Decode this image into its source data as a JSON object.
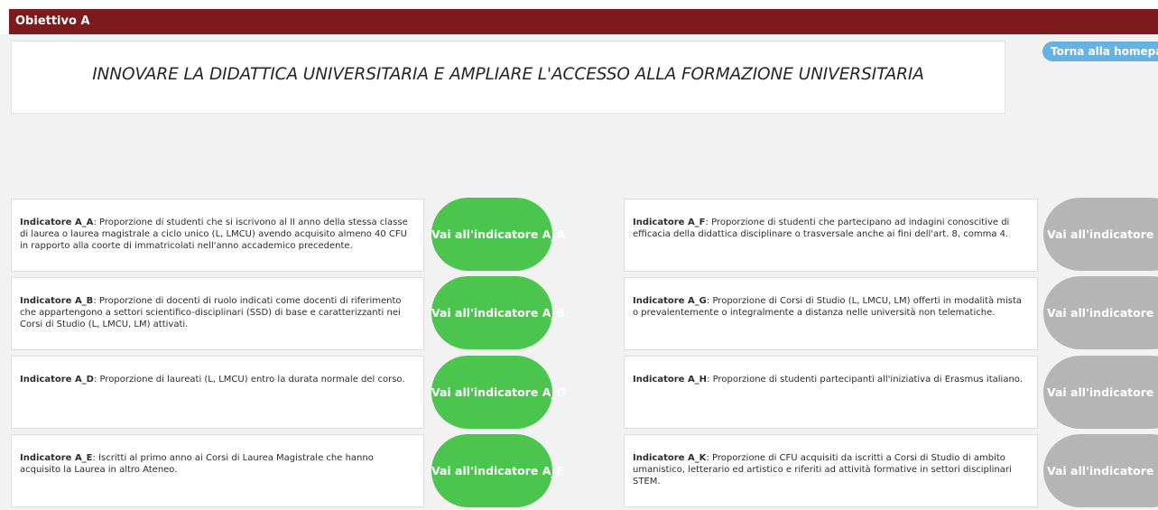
{
  "header": {
    "title": "Obiettivo A"
  },
  "objective": {
    "title": "INNOVARE LA DIDATTICA UNIVERSITARIA E AMPLIARE L'ACCESSO ALLA FORMAZIONE UNIVERSITARIA"
  },
  "home_button": {
    "label": "Torna alla homepage"
  },
  "indicators_left": [
    {
      "name": "Indicatore A_A",
      "description": ": Proporzione di studenti che si iscrivono al II anno della stessa classe di laurea o laurea magistrale a ciclo unico (L, LMCU) avendo acquisito almeno 40 CFU in rapporto alla coorte di immatricolati nell'anno accademico precedente.",
      "button_label": "Vai all'indicatore A_A",
      "button_color": "#4cc54f"
    },
    {
      "name": "Indicatore A_B",
      "description": ": Proporzione di docenti di ruolo indicati come docenti di riferimento che appartengono a settori scientifico-disciplinari (SSD) di base e caratterizzanti nei Corsi di Studio (L, LMCU, LM) attivati.",
      "button_label": "Vai all'indicatore A_B",
      "button_color": "#4cc54f"
    },
    {
      "name": "Indicatore A_D",
      "description": ": Proporzione di laureati (L, LMCU) entro la durata normale del corso.",
      "button_label": "Vai all'indicatore A_D",
      "button_color": "#4cc54f"
    },
    {
      "name": "Indicatore A_E",
      "description": ": Iscritti al primo anno ai Corsi di Laurea Magistrale che hanno acquisito la Laurea in altro Ateneo.",
      "button_label": "Vai all'indicatore A_E",
      "button_color": "#4cc54f"
    }
  ],
  "indicators_right": [
    {
      "name": "Indicatore A_F",
      "description": ": Proporzione di studenti che partecipano ad indagini conoscitive di efficacia della didattica disciplinare o trasversale anche ai fini dell'art. 8, comma 4.",
      "button_label": "Vai all'indicatore A_F",
      "button_color": "#b5b5b5"
    },
    {
      "name": "Indicatore A_G",
      "description": ": Proporzione di Corsi di Studio (L, LMCU, LM) offerti in modalità mista o prevalentemente o integralmente a distanza nelle università non telematiche.",
      "button_label": "Vai all'indicatore A_G",
      "button_color": "#b5b5b5"
    },
    {
      "name": "Indicatore A_H",
      "description": ": Proporzione di studenti partecipanti all'iniziativa di Erasmus italiano.",
      "button_label": "Vai all'indicatore A_H",
      "button_color": "#b5b5b5"
    },
    {
      "name": "Indicatore A_K",
      "description": ": Proporzione di CFU acquisiti da iscritti a Corsi di Studio di ambito umanistico, letterario ed artistico e riferiti ad attività formative in settori disciplinari STEM.",
      "button_label": "Vai all'indicatore A_K",
      "button_color": "#b5b5b5"
    }
  ]
}
